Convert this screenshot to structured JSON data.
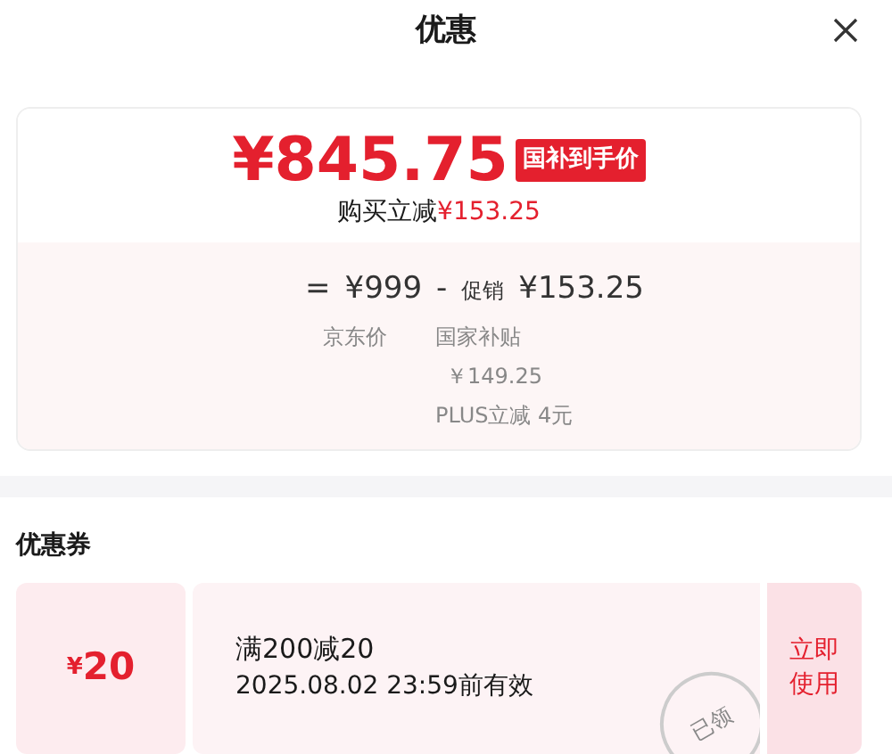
{
  "header": {
    "title": "优惠"
  },
  "price_card": {
    "price": "¥845.75",
    "badge": "国补到手价",
    "saving_label": "购买立减",
    "saving_amount": "¥153.25",
    "formula": {
      "equals": "=",
      "base": "¥999",
      "minus": "-",
      "promo_label": "促销",
      "promo_amount": "¥153.25"
    },
    "base_caption": "京东价",
    "promo_details": [
      "国家补贴",
      "￥149.25",
      "PLUS立减 4元"
    ]
  },
  "coupons": {
    "title": "优惠券",
    "items": [
      {
        "currency": "¥",
        "amount": "20",
        "rule": "满200减20",
        "validity": "2025.08.02 23:59前有效",
        "action": "立即使用",
        "claimed": true,
        "stamp": "已领"
      }
    ]
  }
}
